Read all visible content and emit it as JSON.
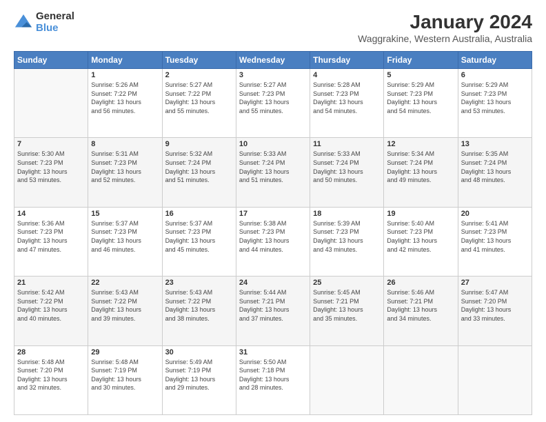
{
  "logo": {
    "line1": "General",
    "line2": "Blue"
  },
  "title": "January 2024",
  "subtitle": "Waggrakine, Western Australia, Australia",
  "days_of_week": [
    "Sunday",
    "Monday",
    "Tuesday",
    "Wednesday",
    "Thursday",
    "Friday",
    "Saturday"
  ],
  "weeks": [
    [
      {
        "day": "",
        "info": ""
      },
      {
        "day": "1",
        "info": "Sunrise: 5:26 AM\nSunset: 7:22 PM\nDaylight: 13 hours\nand 56 minutes."
      },
      {
        "day": "2",
        "info": "Sunrise: 5:27 AM\nSunset: 7:22 PM\nDaylight: 13 hours\nand 55 minutes."
      },
      {
        "day": "3",
        "info": "Sunrise: 5:27 AM\nSunset: 7:23 PM\nDaylight: 13 hours\nand 55 minutes."
      },
      {
        "day": "4",
        "info": "Sunrise: 5:28 AM\nSunset: 7:23 PM\nDaylight: 13 hours\nand 54 minutes."
      },
      {
        "day": "5",
        "info": "Sunrise: 5:29 AM\nSunset: 7:23 PM\nDaylight: 13 hours\nand 54 minutes."
      },
      {
        "day": "6",
        "info": "Sunrise: 5:29 AM\nSunset: 7:23 PM\nDaylight: 13 hours\nand 53 minutes."
      }
    ],
    [
      {
        "day": "7",
        "info": "Sunrise: 5:30 AM\nSunset: 7:23 PM\nDaylight: 13 hours\nand 53 minutes."
      },
      {
        "day": "8",
        "info": "Sunrise: 5:31 AM\nSunset: 7:23 PM\nDaylight: 13 hours\nand 52 minutes."
      },
      {
        "day": "9",
        "info": "Sunrise: 5:32 AM\nSunset: 7:24 PM\nDaylight: 13 hours\nand 51 minutes."
      },
      {
        "day": "10",
        "info": "Sunrise: 5:33 AM\nSunset: 7:24 PM\nDaylight: 13 hours\nand 51 minutes."
      },
      {
        "day": "11",
        "info": "Sunrise: 5:33 AM\nSunset: 7:24 PM\nDaylight: 13 hours\nand 50 minutes."
      },
      {
        "day": "12",
        "info": "Sunrise: 5:34 AM\nSunset: 7:24 PM\nDaylight: 13 hours\nand 49 minutes."
      },
      {
        "day": "13",
        "info": "Sunrise: 5:35 AM\nSunset: 7:24 PM\nDaylight: 13 hours\nand 48 minutes."
      }
    ],
    [
      {
        "day": "14",
        "info": "Sunrise: 5:36 AM\nSunset: 7:23 PM\nDaylight: 13 hours\nand 47 minutes."
      },
      {
        "day": "15",
        "info": "Sunrise: 5:37 AM\nSunset: 7:23 PM\nDaylight: 13 hours\nand 46 minutes."
      },
      {
        "day": "16",
        "info": "Sunrise: 5:37 AM\nSunset: 7:23 PM\nDaylight: 13 hours\nand 45 minutes."
      },
      {
        "day": "17",
        "info": "Sunrise: 5:38 AM\nSunset: 7:23 PM\nDaylight: 13 hours\nand 44 minutes."
      },
      {
        "day": "18",
        "info": "Sunrise: 5:39 AM\nSunset: 7:23 PM\nDaylight: 13 hours\nand 43 minutes."
      },
      {
        "day": "19",
        "info": "Sunrise: 5:40 AM\nSunset: 7:23 PM\nDaylight: 13 hours\nand 42 minutes."
      },
      {
        "day": "20",
        "info": "Sunrise: 5:41 AM\nSunset: 7:23 PM\nDaylight: 13 hours\nand 41 minutes."
      }
    ],
    [
      {
        "day": "21",
        "info": "Sunrise: 5:42 AM\nSunset: 7:22 PM\nDaylight: 13 hours\nand 40 minutes."
      },
      {
        "day": "22",
        "info": "Sunrise: 5:43 AM\nSunset: 7:22 PM\nDaylight: 13 hours\nand 39 minutes."
      },
      {
        "day": "23",
        "info": "Sunrise: 5:43 AM\nSunset: 7:22 PM\nDaylight: 13 hours\nand 38 minutes."
      },
      {
        "day": "24",
        "info": "Sunrise: 5:44 AM\nSunset: 7:21 PM\nDaylight: 13 hours\nand 37 minutes."
      },
      {
        "day": "25",
        "info": "Sunrise: 5:45 AM\nSunset: 7:21 PM\nDaylight: 13 hours\nand 35 minutes."
      },
      {
        "day": "26",
        "info": "Sunrise: 5:46 AM\nSunset: 7:21 PM\nDaylight: 13 hours\nand 34 minutes."
      },
      {
        "day": "27",
        "info": "Sunrise: 5:47 AM\nSunset: 7:20 PM\nDaylight: 13 hours\nand 33 minutes."
      }
    ],
    [
      {
        "day": "28",
        "info": "Sunrise: 5:48 AM\nSunset: 7:20 PM\nDaylight: 13 hours\nand 32 minutes."
      },
      {
        "day": "29",
        "info": "Sunrise: 5:48 AM\nSunset: 7:19 PM\nDaylight: 13 hours\nand 30 minutes."
      },
      {
        "day": "30",
        "info": "Sunrise: 5:49 AM\nSunset: 7:19 PM\nDaylight: 13 hours\nand 29 minutes."
      },
      {
        "day": "31",
        "info": "Sunrise: 5:50 AM\nSunset: 7:18 PM\nDaylight: 13 hours\nand 28 minutes."
      },
      {
        "day": "",
        "info": ""
      },
      {
        "day": "",
        "info": ""
      },
      {
        "day": "",
        "info": ""
      }
    ]
  ]
}
